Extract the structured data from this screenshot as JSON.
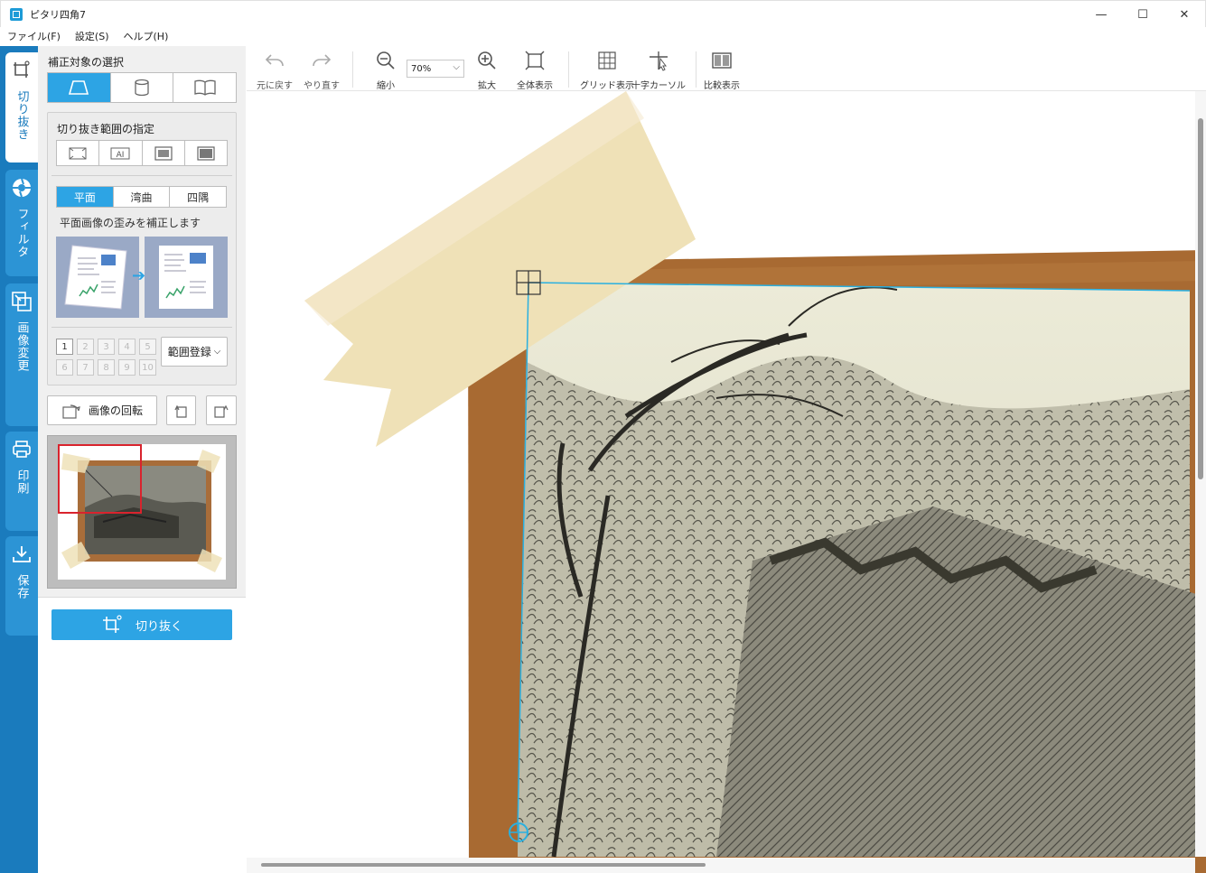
{
  "window": {
    "title": "ピタリ四角7",
    "minimize": "—",
    "maximize": "☐",
    "close": "✕"
  },
  "menu": [
    "ファイル(F)",
    "設定(S)",
    "ヘルプ(H)"
  ],
  "rail_tabs": [
    {
      "label": "切り抜き",
      "icon": "crop-icon",
      "active": true
    },
    {
      "label": "フィルタ",
      "icon": "aperture-icon",
      "active": false
    },
    {
      "label": "画像変更",
      "icon": "image-resize-icon",
      "active": false
    },
    {
      "label": "印刷",
      "icon": "printer-icon",
      "active": false
    },
    {
      "label": "保存",
      "icon": "download-icon",
      "active": false
    }
  ],
  "panel": {
    "target_title": "補正対象の選択",
    "crop_range_title": "切り抜き範囲の指定",
    "modes": [
      "平面",
      "湾曲",
      "四隅"
    ],
    "mode_desc": "平面画像の歪みを補正します",
    "slots": [
      "1",
      "2",
      "3",
      "4",
      "5",
      "6",
      "7",
      "8",
      "9",
      "10"
    ],
    "register_label": "範囲登録",
    "rotate_label": "画像の回転",
    "crop_action_label": "切り抜く"
  },
  "toolbar": {
    "undo": "元に戻す",
    "redo": "やり直す",
    "zoom_out": "縮小",
    "zoom_value": "70%",
    "zoom_in": "拡大",
    "fit": "全体表示",
    "grid": "グリッド表示",
    "crosshair": "十字カーソル",
    "compare": "比較表示"
  },
  "colors": {
    "accent": "#2da4e4",
    "rail": "#1a7bbd",
    "crop_line": "#2ab0e0",
    "thumb_frame": "#d9232d"
  }
}
